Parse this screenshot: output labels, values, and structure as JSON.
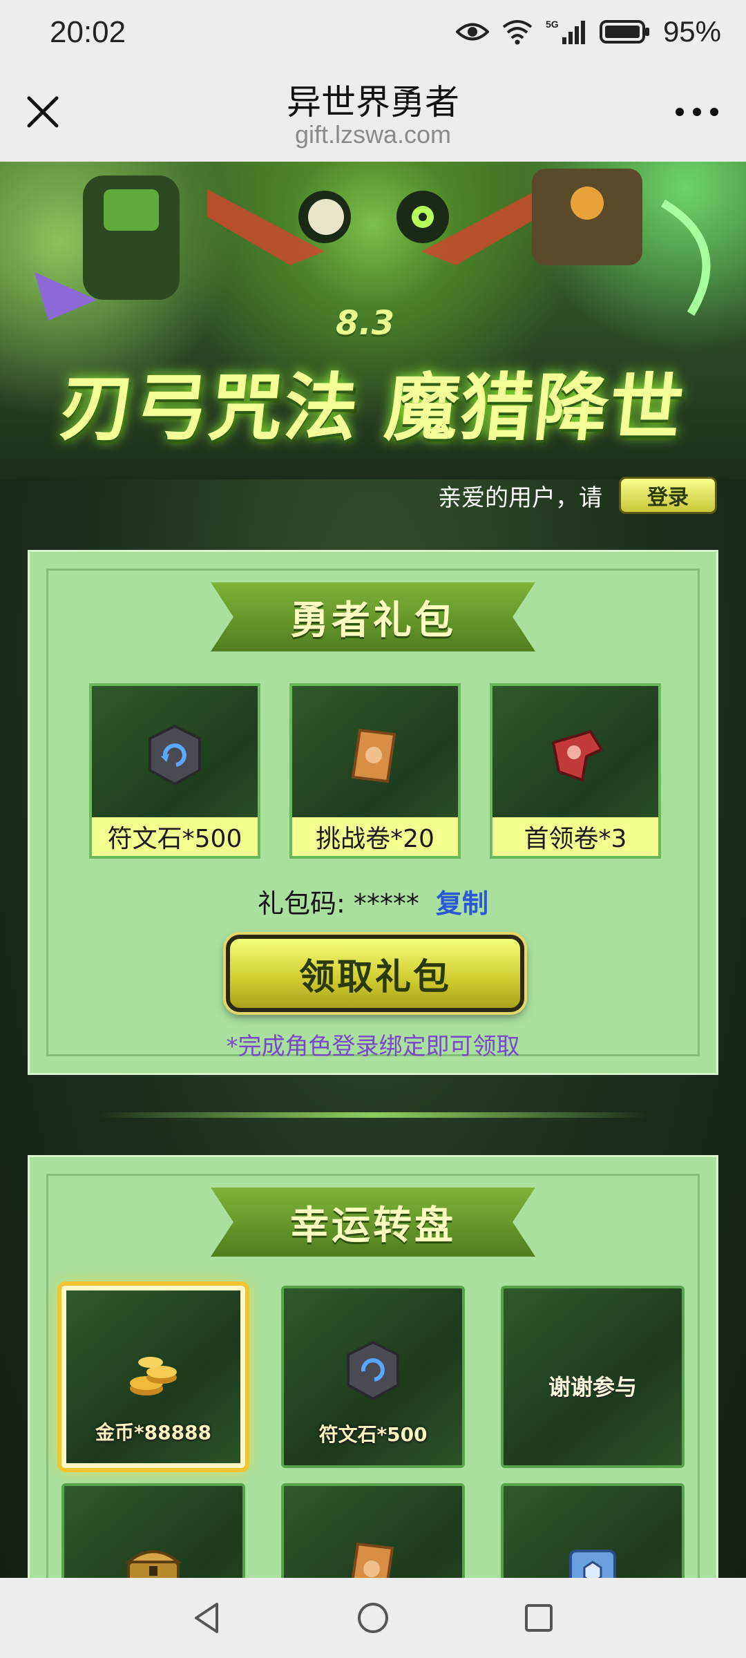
{
  "status_bar": {
    "time": "20:02",
    "network": "5G",
    "battery_percent": "95%",
    "icons": [
      "eye-icon",
      "wifi-icon",
      "signal-icon",
      "battery-icon"
    ]
  },
  "browser": {
    "title": "异世界勇者",
    "url": "gift.lzswa.com",
    "close_icon": "close-icon",
    "more_icon": "more-icon"
  },
  "hero": {
    "version": "8.3",
    "title": "刃弓咒法 魔猎降世"
  },
  "user": {
    "greeting": "亲爱的用户，请",
    "login_label": "登录"
  },
  "gift_pack": {
    "title": "勇者礼包",
    "items": [
      {
        "label": "符文石*500",
        "icon": "rune-stone-icon"
      },
      {
        "label": "挑战卷*20",
        "icon": "challenge-scroll-icon"
      },
      {
        "label": "首领卷*3",
        "icon": "boss-scroll-icon"
      }
    ],
    "code_label": "礼包码: *****",
    "copy_label": "复制",
    "claim_label": "领取礼包",
    "note": "*完成角色登录绑定即可领取"
  },
  "lucky_wheel": {
    "title": "幸运转盘",
    "cells": [
      {
        "label": "金币*88888",
        "icon": "gold-coins-icon",
        "active": true
      },
      {
        "label": "符文石*500",
        "icon": "rune-stone-icon",
        "active": false
      },
      {
        "label": "谢谢参与",
        "icon": "",
        "active": false
      },
      {
        "label": "",
        "icon": "treasure-chest-icon",
        "active": false
      },
      {
        "label": "",
        "icon": "challenge-scroll-icon",
        "active": false
      },
      {
        "label": "",
        "icon": "blue-chest-icon",
        "active": false
      }
    ]
  },
  "nav_bar": {
    "icons": [
      "back-icon",
      "home-icon",
      "recents-icon"
    ]
  }
}
